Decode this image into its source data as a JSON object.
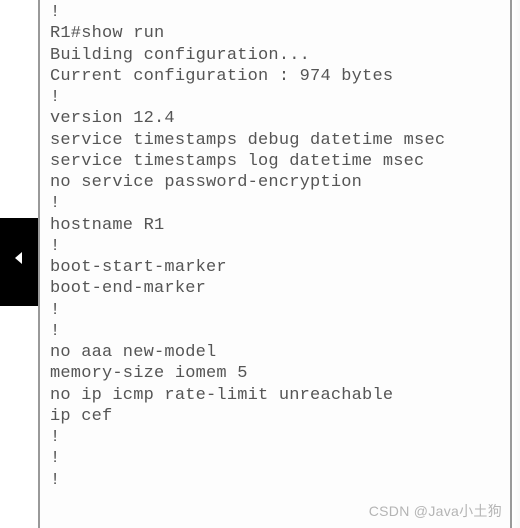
{
  "terminal": {
    "lines": [
      "!",
      "R1#show run",
      "Building configuration...",
      "",
      "Current configuration : 974 bytes",
      "!",
      "version 12.4",
      "service timestamps debug datetime msec",
      "service timestamps log datetime msec",
      "no service password-encryption",
      "!",
      "hostname R1",
      "!",
      "boot-start-marker",
      "boot-end-marker",
      "!",
      "!",
      "no aaa new-model",
      "memory-size iomem 5",
      "no ip icmp rate-limit unreachable",
      "ip cef",
      "!",
      "!",
      "!"
    ]
  },
  "sidebar": {
    "icon": "triangle-left-icon"
  },
  "watermark": {
    "text": "CSDN @Java小土狗"
  }
}
